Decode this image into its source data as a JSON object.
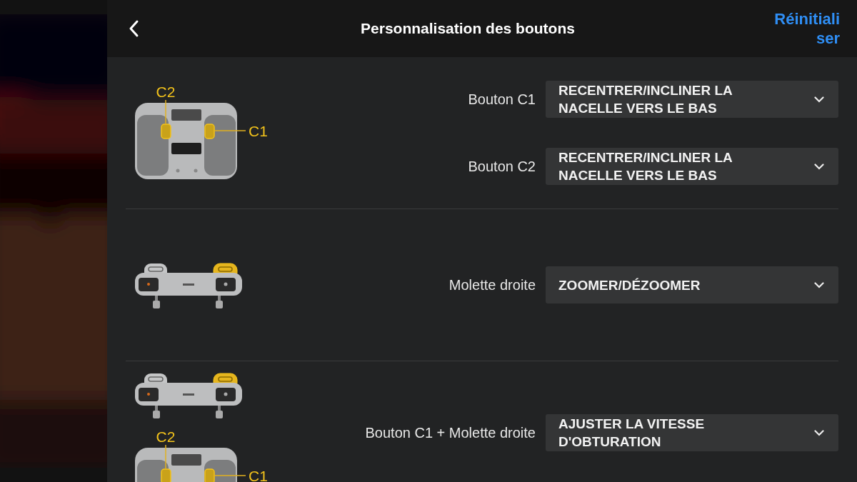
{
  "header": {
    "title": "Personnalisation des boutons",
    "reset_button": "Réinitialiser"
  },
  "sections": [
    {
      "images": [
        {
          "kind": "back",
          "callouts": [
            "C2",
            "C1"
          ]
        }
      ],
      "rows": [
        {
          "label": "Bouton C1",
          "value": "RECENTRER/INCLINER LA NACELLE VERS LE BAS"
        },
        {
          "label": "Bouton C2",
          "value": "RECENTRER/INCLINER LA NACELLE VERS LE BAS"
        }
      ]
    },
    {
      "images": [
        {
          "kind": "top"
        }
      ],
      "rows": [
        {
          "label": "Molette droite",
          "value": "ZOOMER/DÉZOOMER"
        }
      ]
    },
    {
      "images": [
        {
          "kind": "top"
        },
        {
          "kind": "back",
          "callouts": [
            "C2",
            "C1"
          ]
        }
      ],
      "rows": [
        {
          "label": "Bouton C1 + Molette droite",
          "value": "AJUSTER LA VITESSE D'OBTURATION"
        }
      ]
    }
  ]
}
